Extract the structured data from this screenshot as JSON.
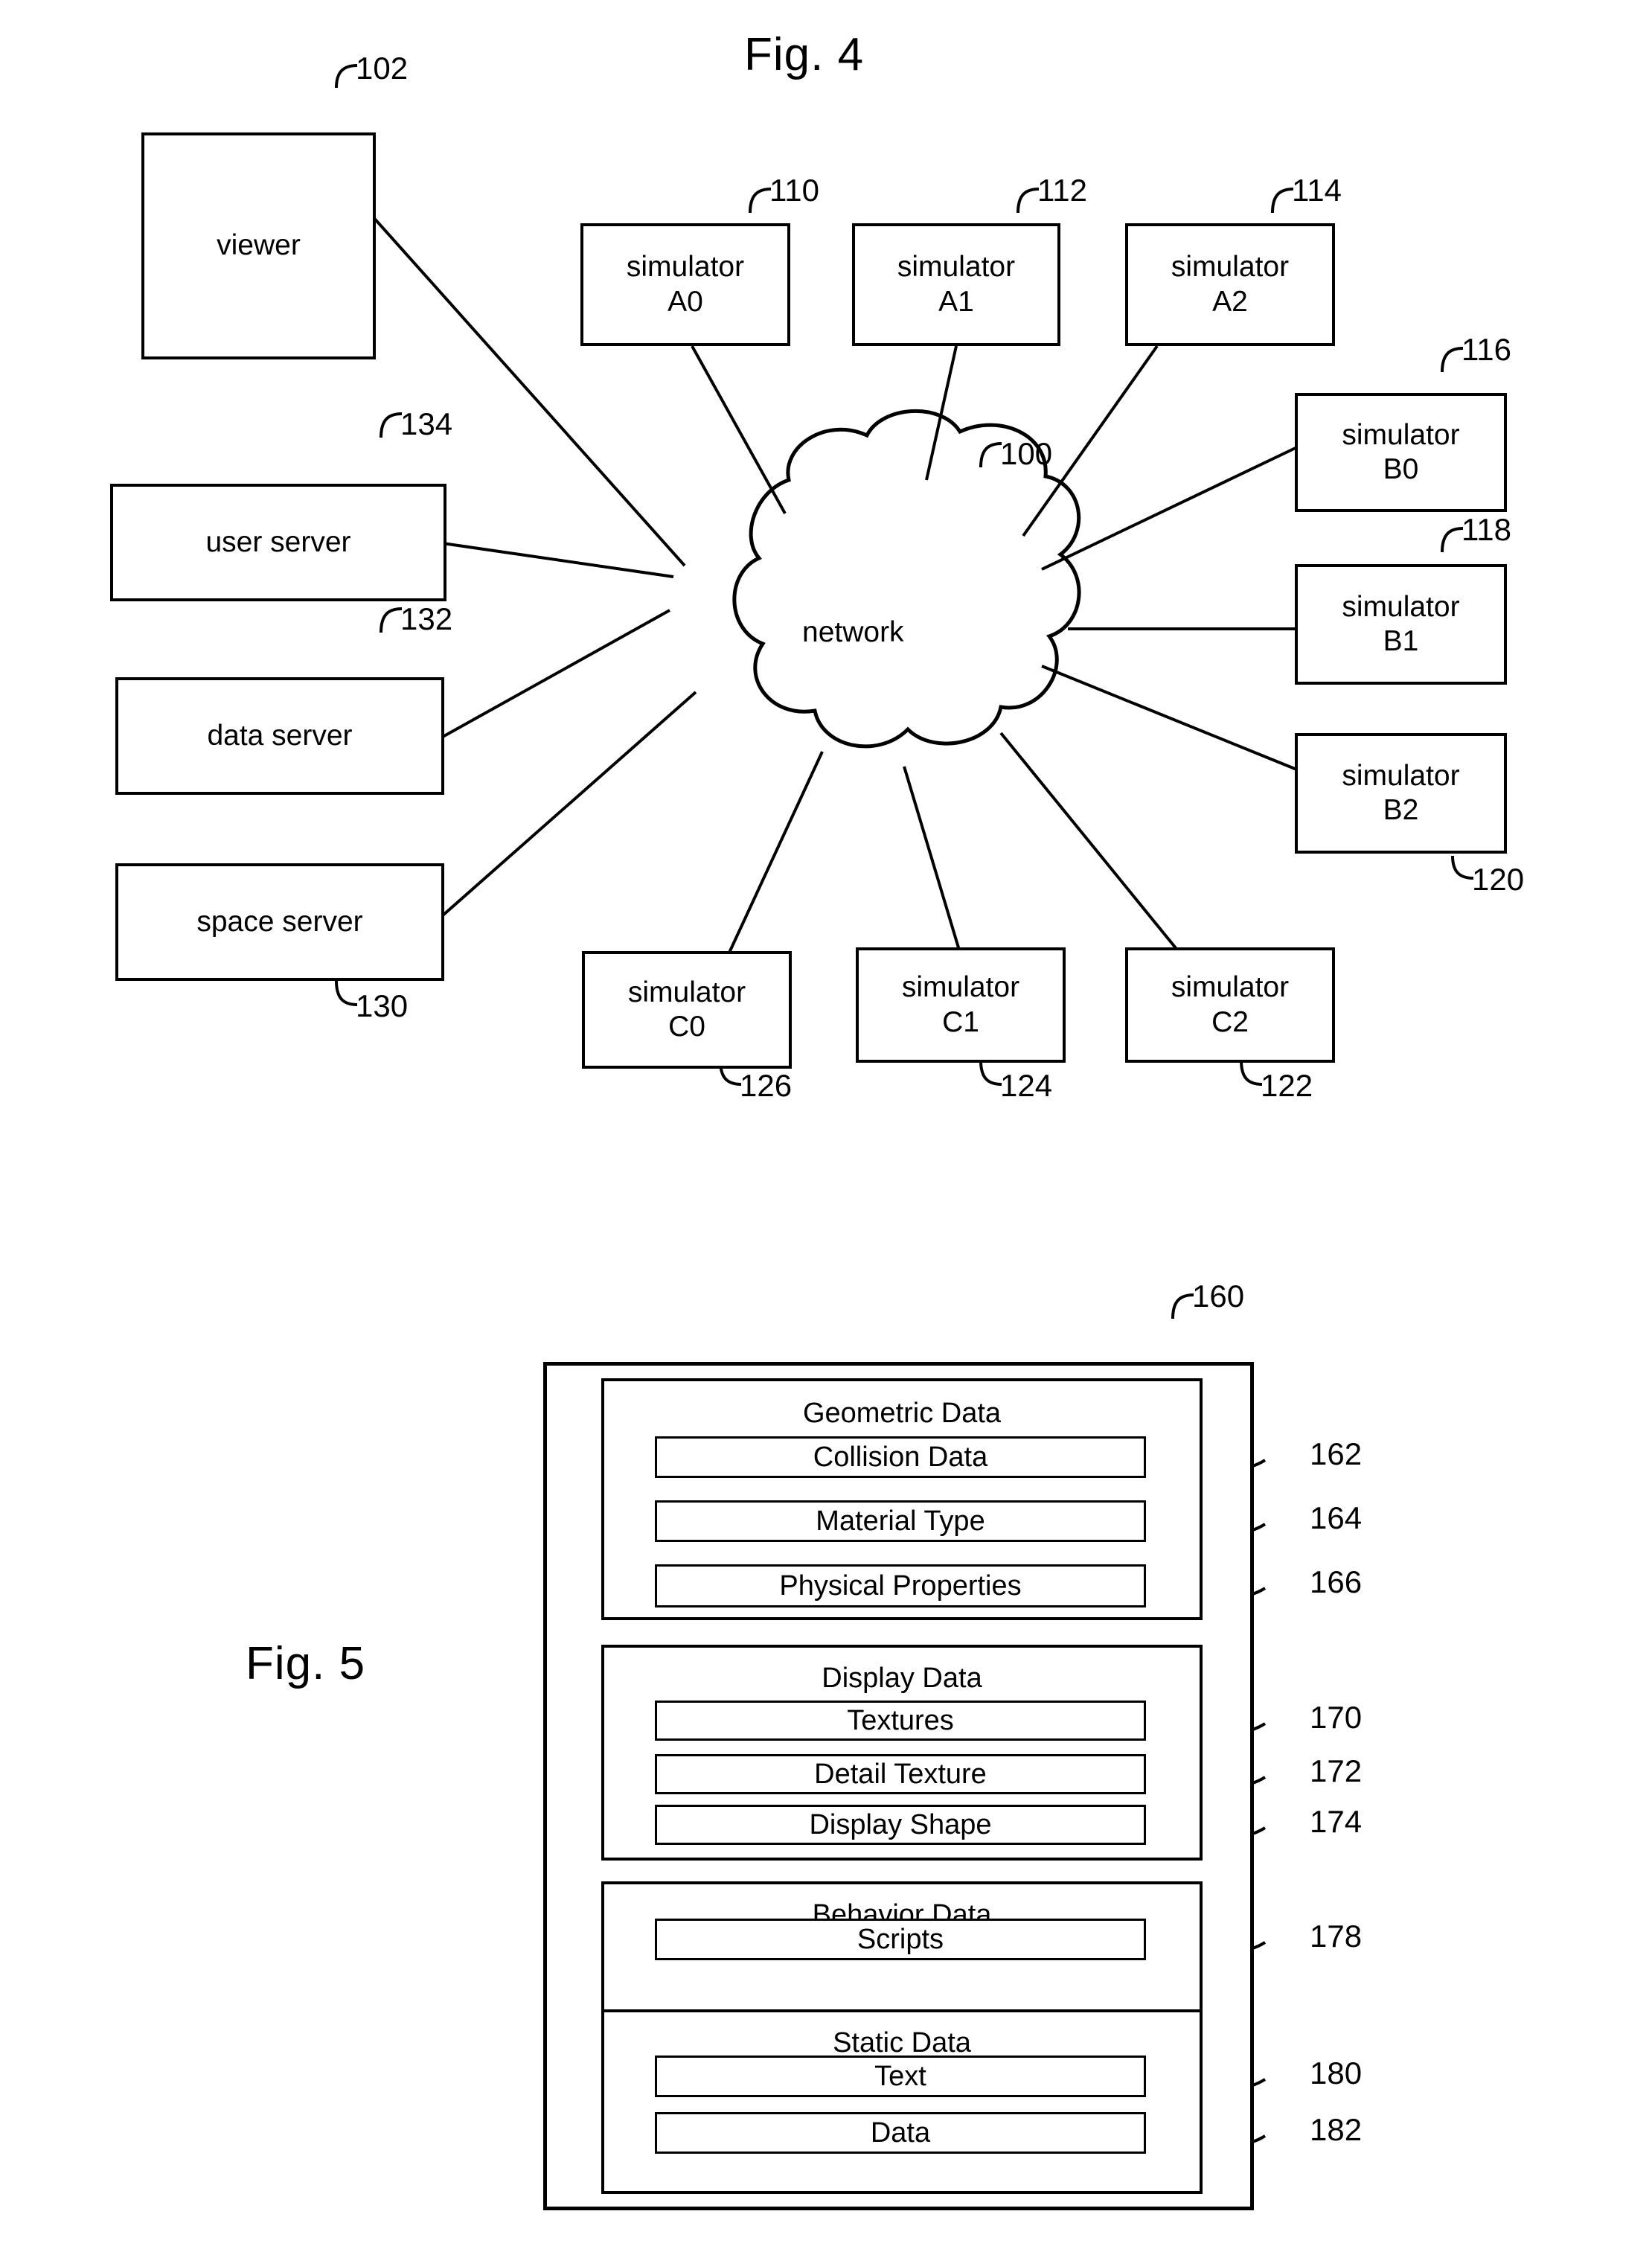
{
  "figures": {
    "fig4": {
      "title": "Fig. 4",
      "network_label": "network",
      "network_ref": "100",
      "nodes": [
        {
          "id": "viewer",
          "label": "viewer",
          "ref": "102"
        },
        {
          "id": "sim_a0",
          "label": "simulator\nA0",
          "ref": "110"
        },
        {
          "id": "sim_a1",
          "label": "simulator\nA1",
          "ref": "112"
        },
        {
          "id": "sim_a2",
          "label": "simulator\nA2",
          "ref": "114"
        },
        {
          "id": "sim_b0",
          "label": "simulator\nB0",
          "ref": "116"
        },
        {
          "id": "sim_b1",
          "label": "simulator\nB1",
          "ref": "118"
        },
        {
          "id": "sim_b2",
          "label": "simulator\nB2",
          "ref": "120"
        },
        {
          "id": "sim_c2",
          "label": "simulator\nC2",
          "ref": "122"
        },
        {
          "id": "sim_c1",
          "label": "simulator\nC1",
          "ref": "124"
        },
        {
          "id": "sim_c0",
          "label": "simulator\nC0",
          "ref": "126"
        },
        {
          "id": "space_server",
          "label": "space server",
          "ref": "130"
        },
        {
          "id": "data_server",
          "label": "data server",
          "ref": "132"
        },
        {
          "id": "user_server",
          "label": "user server",
          "ref": "134"
        }
      ]
    },
    "fig5": {
      "title": "Fig. 5",
      "outer_ref": "160",
      "groups": [
        {
          "id": "geometric",
          "title": "Geometric Data",
          "items": [
            {
              "label": "Collision Data",
              "ref": "162"
            },
            {
              "label": "Material Type",
              "ref": "164"
            },
            {
              "label": "Physical Properties",
              "ref": "166"
            }
          ]
        },
        {
          "id": "display",
          "title": "Display Data",
          "items": [
            {
              "label": "Textures",
              "ref": "170"
            },
            {
              "label": "Detail Texture",
              "ref": "172"
            },
            {
              "label": "Display Shape",
              "ref": "174"
            }
          ]
        },
        {
          "id": "behavior",
          "title": "Behavior  Data",
          "items": [
            {
              "label": "Scripts",
              "ref": "178"
            }
          ]
        },
        {
          "id": "static",
          "title": "Static Data",
          "items": [
            {
              "label": "Text",
              "ref": "180"
            },
            {
              "label": "Data",
              "ref": "182"
            }
          ]
        }
      ]
    }
  }
}
